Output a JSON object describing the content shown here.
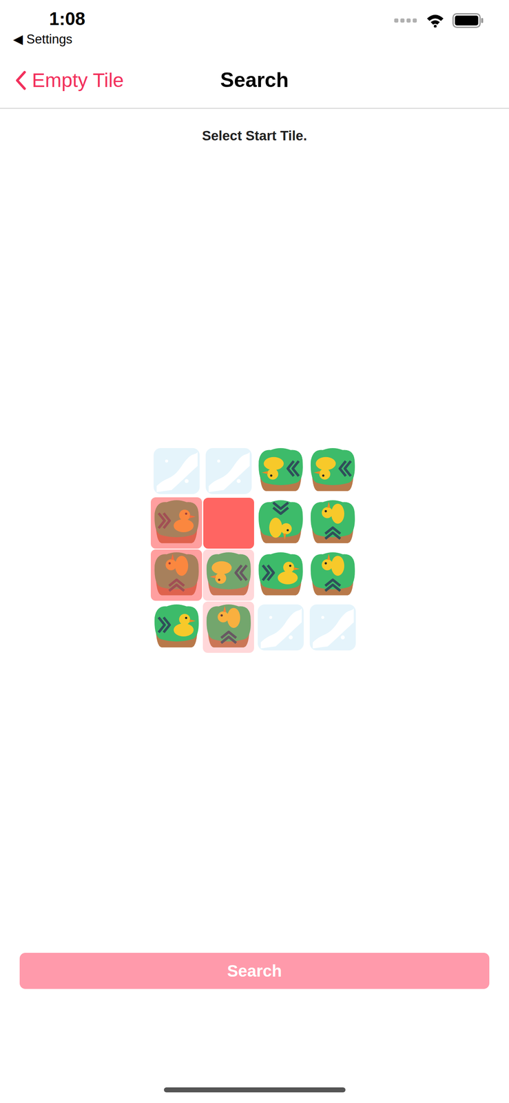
{
  "status_bar": {
    "time": "1:08",
    "back_app": "◀ Settings"
  },
  "nav_bar": {
    "back_label": "Empty Tile",
    "title": "Search"
  },
  "prompt": "Select Start Tile.",
  "board": {
    "rows": [
      [
        {
          "kind": "water",
          "direction": "none",
          "highlight": "none"
        },
        {
          "kind": "water",
          "direction": "none",
          "highlight": "none"
        },
        {
          "kind": "duck",
          "direction": "left",
          "highlight": "none"
        },
        {
          "kind": "duck",
          "direction": "left",
          "highlight": "none"
        }
      ],
      [
        {
          "kind": "duck",
          "direction": "right",
          "highlight": "strong"
        },
        {
          "kind": "empty",
          "direction": "none",
          "highlight": "strong"
        },
        {
          "kind": "duck",
          "direction": "down",
          "highlight": "none"
        },
        {
          "kind": "duck",
          "direction": "up",
          "highlight": "none"
        }
      ],
      [
        {
          "kind": "duck",
          "direction": "up",
          "highlight": "strong"
        },
        {
          "kind": "duck",
          "direction": "left",
          "highlight": "light"
        },
        {
          "kind": "duck",
          "direction": "right",
          "highlight": "none"
        },
        {
          "kind": "duck",
          "direction": "up",
          "highlight": "none"
        }
      ],
      [
        {
          "kind": "duck",
          "direction": "right",
          "highlight": "none"
        },
        {
          "kind": "duck",
          "direction": "up",
          "highlight": "light"
        },
        {
          "kind": "water",
          "direction": "none",
          "highlight": "none"
        },
        {
          "kind": "water",
          "direction": "none",
          "highlight": "none"
        }
      ]
    ]
  },
  "search_button": {
    "label": "Search",
    "disabled": true
  }
}
